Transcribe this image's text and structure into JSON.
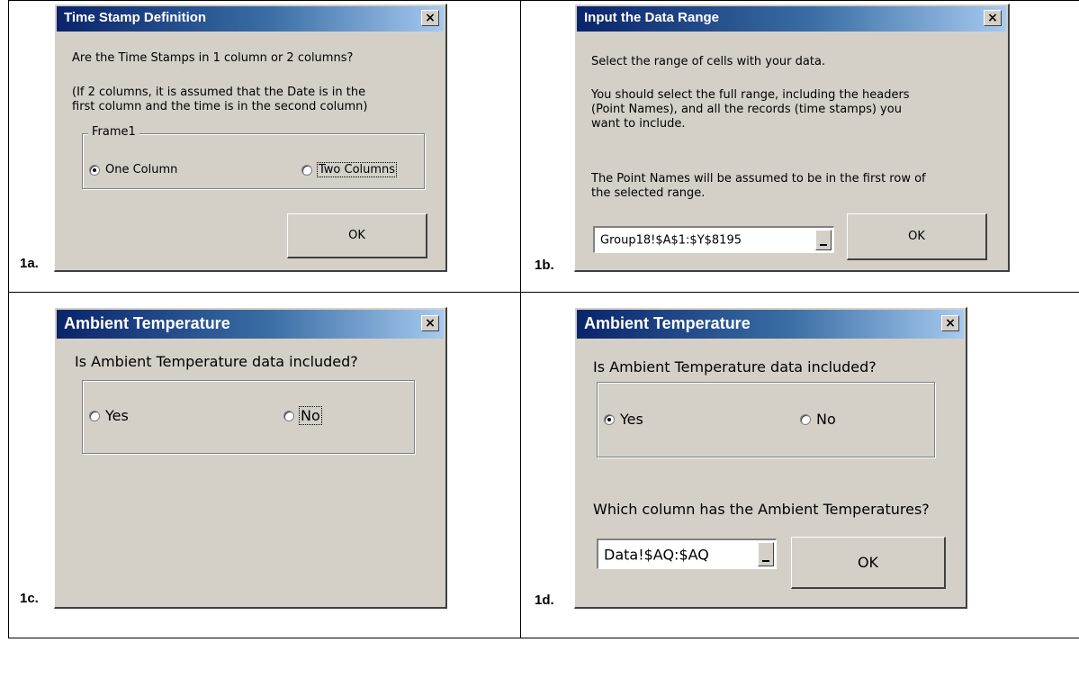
{
  "labels": {
    "a": "1a.",
    "b": "1b.",
    "c": "1c.",
    "d": "1d."
  },
  "dialog_1a": {
    "title": "Time Stamp Definition",
    "close_glyph": "×",
    "question": "Are the Time Stamps in 1 column or 2 columns?",
    "note_line1": "(If 2 columns, it is assumed that the Date is in the",
    "note_line2": "first column and the time is in the second column)",
    "frame_label": "Frame1",
    "option_one": "One Column",
    "option_two": "Two Columns",
    "selected": "One Column",
    "ok_label": "OK"
  },
  "dialog_1b": {
    "title": "Input the Data Range",
    "close_glyph": "×",
    "line1": "Select the range of cells with your data.",
    "line2": "You should select the full range, including the headers",
    "line3": "(Point Names), and all the records (time stamps) you",
    "line4": "want to include.",
    "line5": "The Point Names will be assumed to be in the first row of",
    "line6": "the selected range.",
    "range_value": "Group18!$A$1:$Y$8195",
    "ok_label": "OK"
  },
  "dialog_1c": {
    "title": "Ambient Temperature",
    "close_glyph": "×",
    "question": "Is Ambient Temperature data included?",
    "option_yes": "Yes",
    "option_no": "No",
    "selected": "none"
  },
  "dialog_1d": {
    "title": "Ambient Temperature",
    "close_glyph": "×",
    "question": "Is Ambient Temperature data included?",
    "option_yes": "Yes",
    "option_no": "No",
    "selected": "Yes",
    "column_question": "Which column has the Ambient Temperatures?",
    "range_value": "Data!$AQ:$AQ",
    "ok_label": "OK"
  }
}
